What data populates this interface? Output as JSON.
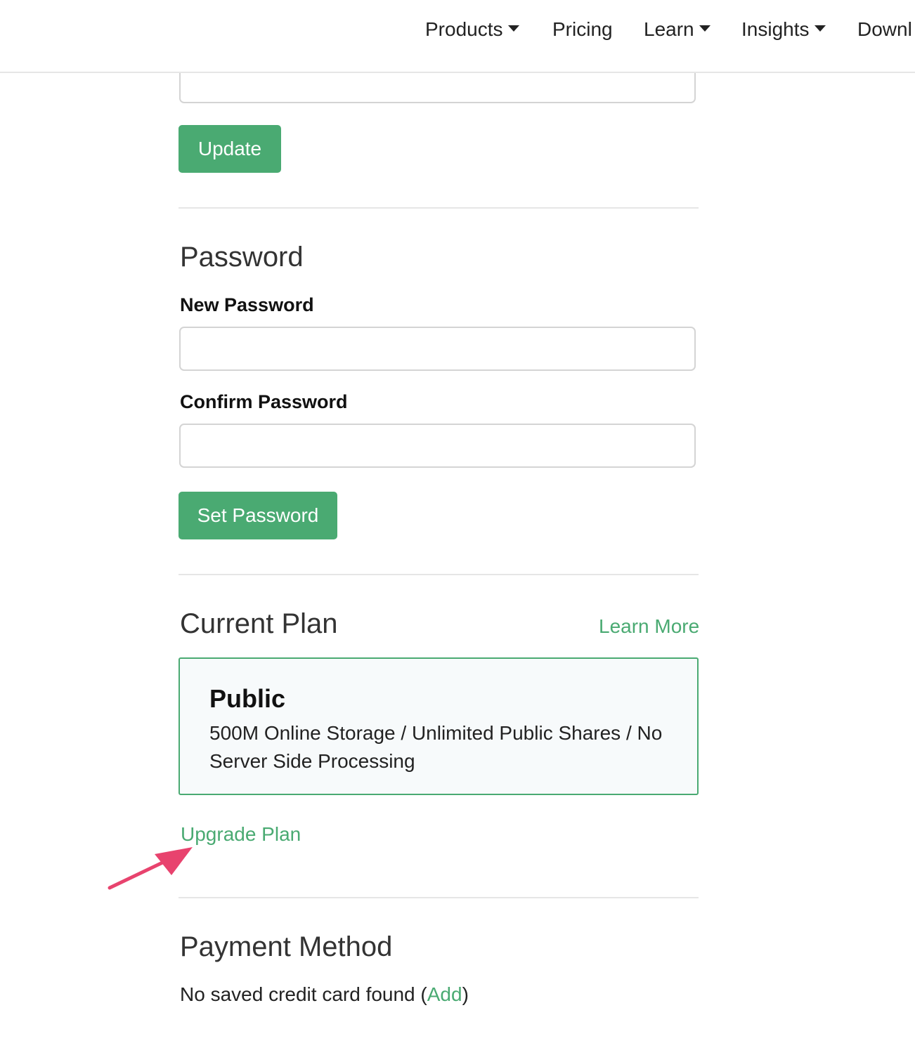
{
  "nav": {
    "items": [
      {
        "label": "Products",
        "has_caret": true
      },
      {
        "label": "Pricing",
        "has_caret": false
      },
      {
        "label": "Learn",
        "has_caret": true
      },
      {
        "label": "Insights",
        "has_caret": true
      },
      {
        "label": "Downl",
        "has_caret": false
      }
    ]
  },
  "profile": {
    "update_button": "Update"
  },
  "password": {
    "title": "Password",
    "new_label": "New Password",
    "new_value": "",
    "confirm_label": "Confirm Password",
    "confirm_value": "",
    "set_button": "Set Password"
  },
  "plan": {
    "title": "Current Plan",
    "learn_more": "Learn More",
    "name": "Public",
    "description": "500M Online Storage /  Unlimited Public Shares / No Server Side Processing",
    "upgrade_link": "Upgrade Plan"
  },
  "payment": {
    "title": "Payment Method",
    "status_text": "No saved credit card found (",
    "add_link": "Add",
    "status_close": ")"
  },
  "colors": {
    "accent_green": "#4aaa72",
    "annotation_arrow": "#e8436e"
  }
}
